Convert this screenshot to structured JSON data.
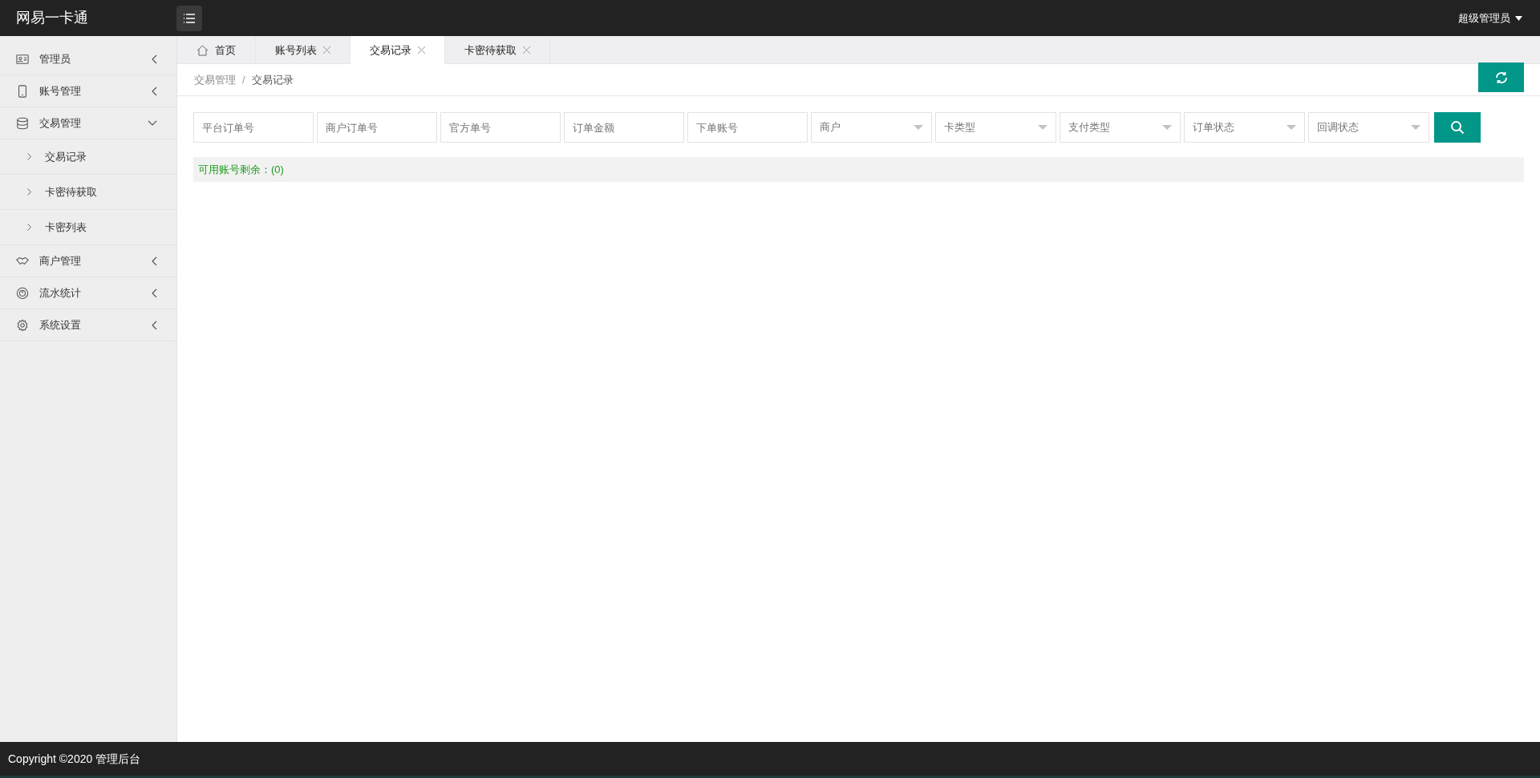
{
  "header": {
    "title": "网易一卡通",
    "user": "超级管理员"
  },
  "sidebar": {
    "items": [
      {
        "label": "管理员",
        "expanded": false
      },
      {
        "label": "账号管理",
        "expanded": false
      },
      {
        "label": "交易管理",
        "expanded": true,
        "children": [
          {
            "label": "交易记录"
          },
          {
            "label": "卡密待获取"
          },
          {
            "label": "卡密列表"
          }
        ]
      },
      {
        "label": "商户管理",
        "expanded": false
      },
      {
        "label": "流水统计",
        "expanded": false
      },
      {
        "label": "系统设置",
        "expanded": false
      }
    ]
  },
  "tabs": [
    {
      "label": "首页",
      "kind": "home",
      "selected": false
    },
    {
      "label": "账号列表",
      "kind": "page",
      "selected": false
    },
    {
      "label": "交易记录",
      "kind": "page",
      "selected": true
    },
    {
      "label": "卡密待获取",
      "kind": "page",
      "selected": false
    }
  ],
  "breadcrumb": {
    "separator": "/",
    "items": [
      "交易管理",
      "交易记录"
    ]
  },
  "filters": [
    {
      "kind": "input",
      "placeholder": "平台订单号"
    },
    {
      "kind": "input",
      "placeholder": "商户订单号"
    },
    {
      "kind": "input",
      "placeholder": "官方单号"
    },
    {
      "kind": "input",
      "placeholder": "订单金额"
    },
    {
      "kind": "input",
      "placeholder": "下单账号"
    },
    {
      "kind": "select",
      "placeholder": "商户"
    },
    {
      "kind": "select",
      "placeholder": "卡类型"
    },
    {
      "kind": "select",
      "placeholder": "支付类型"
    },
    {
      "kind": "select",
      "placeholder": "订单状态"
    },
    {
      "kind": "select",
      "placeholder": "回调状态"
    }
  ],
  "notice": "可用账号剩余：(0)",
  "footer": "Copyright ©2020 管理后台"
}
